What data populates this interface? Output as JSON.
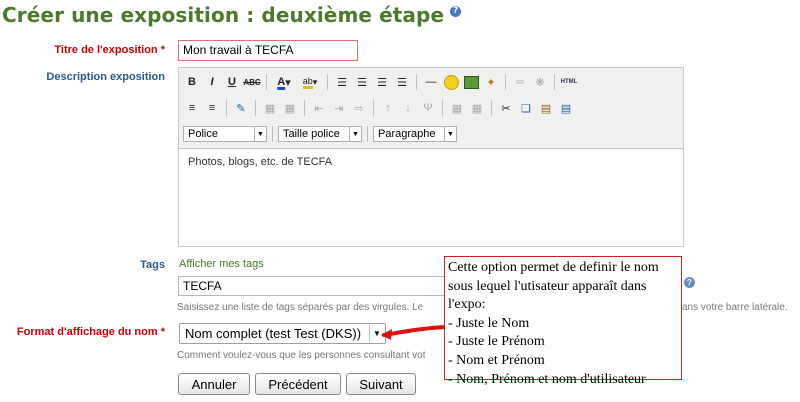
{
  "page": {
    "title": "Créer une exposition : deuxième étape",
    "help_icon": "help-icon"
  },
  "form": {
    "titre_label": "Titre de l'exposition *",
    "titre_value": "Mon travail à TECFA",
    "description_label": "Description exposition",
    "description_content": "Photos, blogs, etc. de TECFA",
    "tags_label": "Tags",
    "tags_link": "Afficher mes tags",
    "tags_value": "TECFA",
    "tags_hint_left": "Saisissez une liste de tags séparés par des virgules. Le",
    "tags_hint_right": "ans votre barre latérale.",
    "format_label": "Format d'affichage du nom *",
    "format_value": "Nom complet (test Test (DKS))",
    "format_hint": "Comment voulez-vous que les personnes consultant vot"
  },
  "editor": {
    "row1": [
      "bold-icon",
      "italic-icon",
      "underline-icon",
      "strikethrough-icon",
      "font-color-icon",
      "highlight-icon",
      "align-left-icon",
      "align-center-icon",
      "align-right-icon",
      "justify-icon",
      "horizontal-rule-icon",
      "smiley-icon",
      "image-icon",
      "cleanup-icon",
      "link-icon",
      "unlink-icon",
      "html-icon"
    ],
    "row2": [
      "bullet-list-icon",
      "numbered-list-icon",
      "edit-icon",
      "table-icon",
      "table-props-icon",
      "cut-icon",
      "copy-icon",
      "paste-icon",
      "paste-word-icon"
    ],
    "font_select": "Police",
    "size_select": "Taille police",
    "format_select": "Paragraphe"
  },
  "buttons": {
    "annuler": "Annuler",
    "precedent": "Précédent",
    "suivant": "Suivant"
  },
  "tooltip": {
    "lines": [
      "Cette option permet de definir le nom",
      "sous lequel l'utisateur apparaît dans",
      "l'expo:",
      "- Juste le Nom",
      "- Juste le Prénom",
      "- Nom et Prénom",
      "- Nom, Prénom et nom d'utilisateur"
    ]
  },
  "colors": {
    "title_green": "#4a7a2a",
    "required_red": "#cc0000",
    "label_blue": "#2a5a8c",
    "annotation_red": "#cc2222"
  }
}
